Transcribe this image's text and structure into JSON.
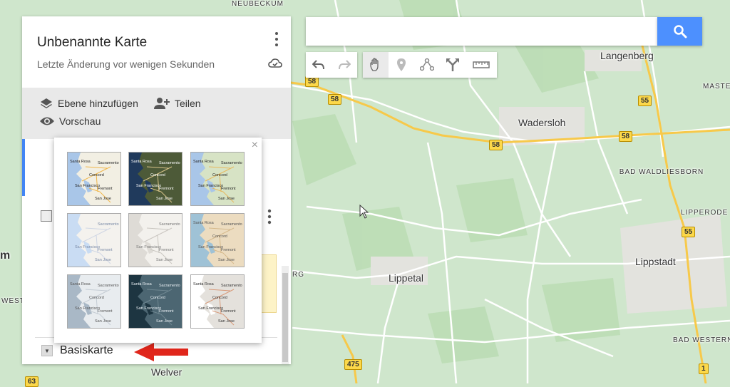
{
  "map": {
    "towns": [
      "NEUBECKUM",
      "Langenberg",
      "Wadersloh",
      "Lippetal",
      "Lippstadt",
      "Welver",
      "BAD WALDLIESBORN",
      "LIPPERODE",
      "BAD WESTERNKOTTEN",
      "MASTE",
      "m",
      "WEST",
      "RG"
    ],
    "road_shields": [
      "58",
      "58",
      "58",
      "55",
      "55",
      "475",
      "1",
      "63"
    ]
  },
  "panel": {
    "title": "Unbenannte Karte",
    "subtitle": "Letzte Änderung vor wenigen Sekunden",
    "add_layer_label": "Ebene hinzufügen",
    "share_label": "Teilen",
    "preview_label": "Vorschau",
    "basemap_label": "Basiskarte"
  },
  "basemap_popup": {
    "close_label": "×",
    "thumbnails": [
      {
        "style": "map",
        "labels": [
          "Santa Rosa",
          "Sacramento",
          "Concord",
          "San Francisco",
          "Fremont",
          "San Jose"
        ]
      },
      {
        "style": "satellite",
        "labels": [
          "Santa Rosa",
          "Sacramento",
          "Concord",
          "San Francisco",
          "Fremont",
          "San Jose"
        ]
      },
      {
        "style": "terrain",
        "labels": [
          "Santa Rosa",
          "Sacramento",
          "Concord",
          "San Francisco",
          "Fremont",
          "San Jose"
        ]
      },
      {
        "style": "light-political",
        "labels": [
          "Sacramento",
          "San Francisco",
          "Fremont",
          "San Jose"
        ]
      },
      {
        "style": "mono-city",
        "labels": [
          "Sacramento",
          "San Francisco",
          "Fremont",
          "San Jose"
        ]
      },
      {
        "style": "simple-atlas",
        "labels": [
          "Santa Rosa",
          "Sacramento",
          "Concord",
          "San Francisco",
          "Fremont",
          "San Jose"
        ]
      },
      {
        "style": "light-landmass",
        "labels": [
          "Santa Rosa",
          "Sacramento",
          "Concord",
          "San Francisco",
          "Fremont",
          "San Jose"
        ]
      },
      {
        "style": "dark-landmass",
        "labels": [
          "Santa Rosa",
          "Sacramento",
          "Concord",
          "San Francisco",
          "Fremont",
          "San Jose"
        ]
      },
      {
        "style": "whitewater",
        "labels": [
          "Santa Rosa",
          "Sacramento",
          "Concord",
          "San Francisco",
          "Fremont",
          "San Jose"
        ]
      }
    ]
  },
  "search": {
    "placeholder": "",
    "value": ""
  },
  "toolbar": {
    "tools": [
      "undo-icon",
      "redo-icon",
      "hand-icon",
      "marker-icon",
      "line-icon",
      "directions-icon",
      "ruler-icon"
    ]
  },
  "colors": {
    "accent_blue": "#4d90fe",
    "layer_bar": "#4285f4",
    "highway_yellow": "#fcd84a",
    "annotation_red": "#e0261b"
  }
}
